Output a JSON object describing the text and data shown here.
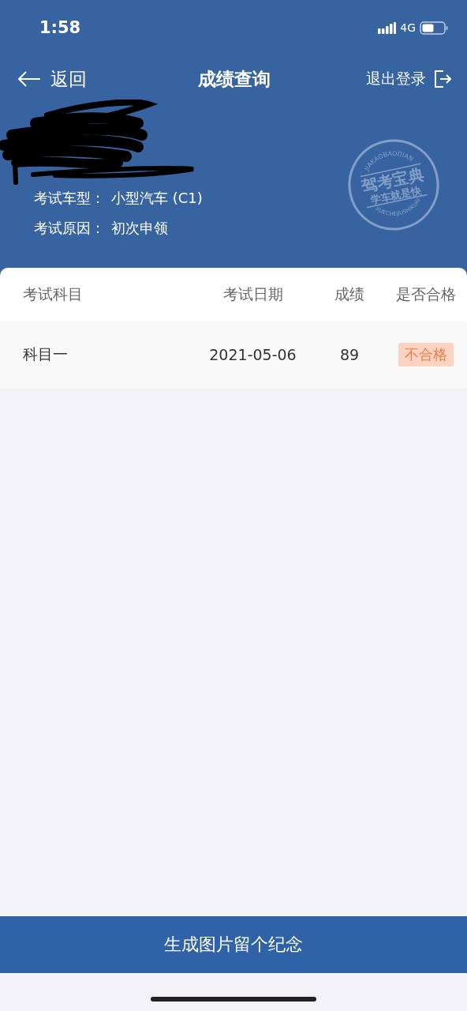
{
  "status_bar": {
    "time": "1:58",
    "network": "4G"
  },
  "nav": {
    "back": "返回",
    "title": "成绩查询",
    "logout": "退出登录"
  },
  "info": {
    "redacted": true,
    "fields": [
      {
        "label": "考试车型：",
        "value": "小型汽车 (C1)"
      },
      {
        "label": "考试原因：",
        "value": "初次申领"
      }
    ]
  },
  "seal": {
    "top_arc": "JIAKAOBAODIAN",
    "line_1": "驾考宝典",
    "line_2": "学车就是快",
    "bottom_arc": "XUECHEJIUSHIKUAI"
  },
  "table": {
    "columns": [
      "考试科目",
      "考试日期",
      "成绩",
      "是否合格"
    ],
    "rows": [
      {
        "subject": "科目一",
        "date": "2021-05-06",
        "score": "89",
        "result": "不合格",
        "passed": false
      }
    ]
  },
  "footer_button": "生成图片留个纪念"
}
